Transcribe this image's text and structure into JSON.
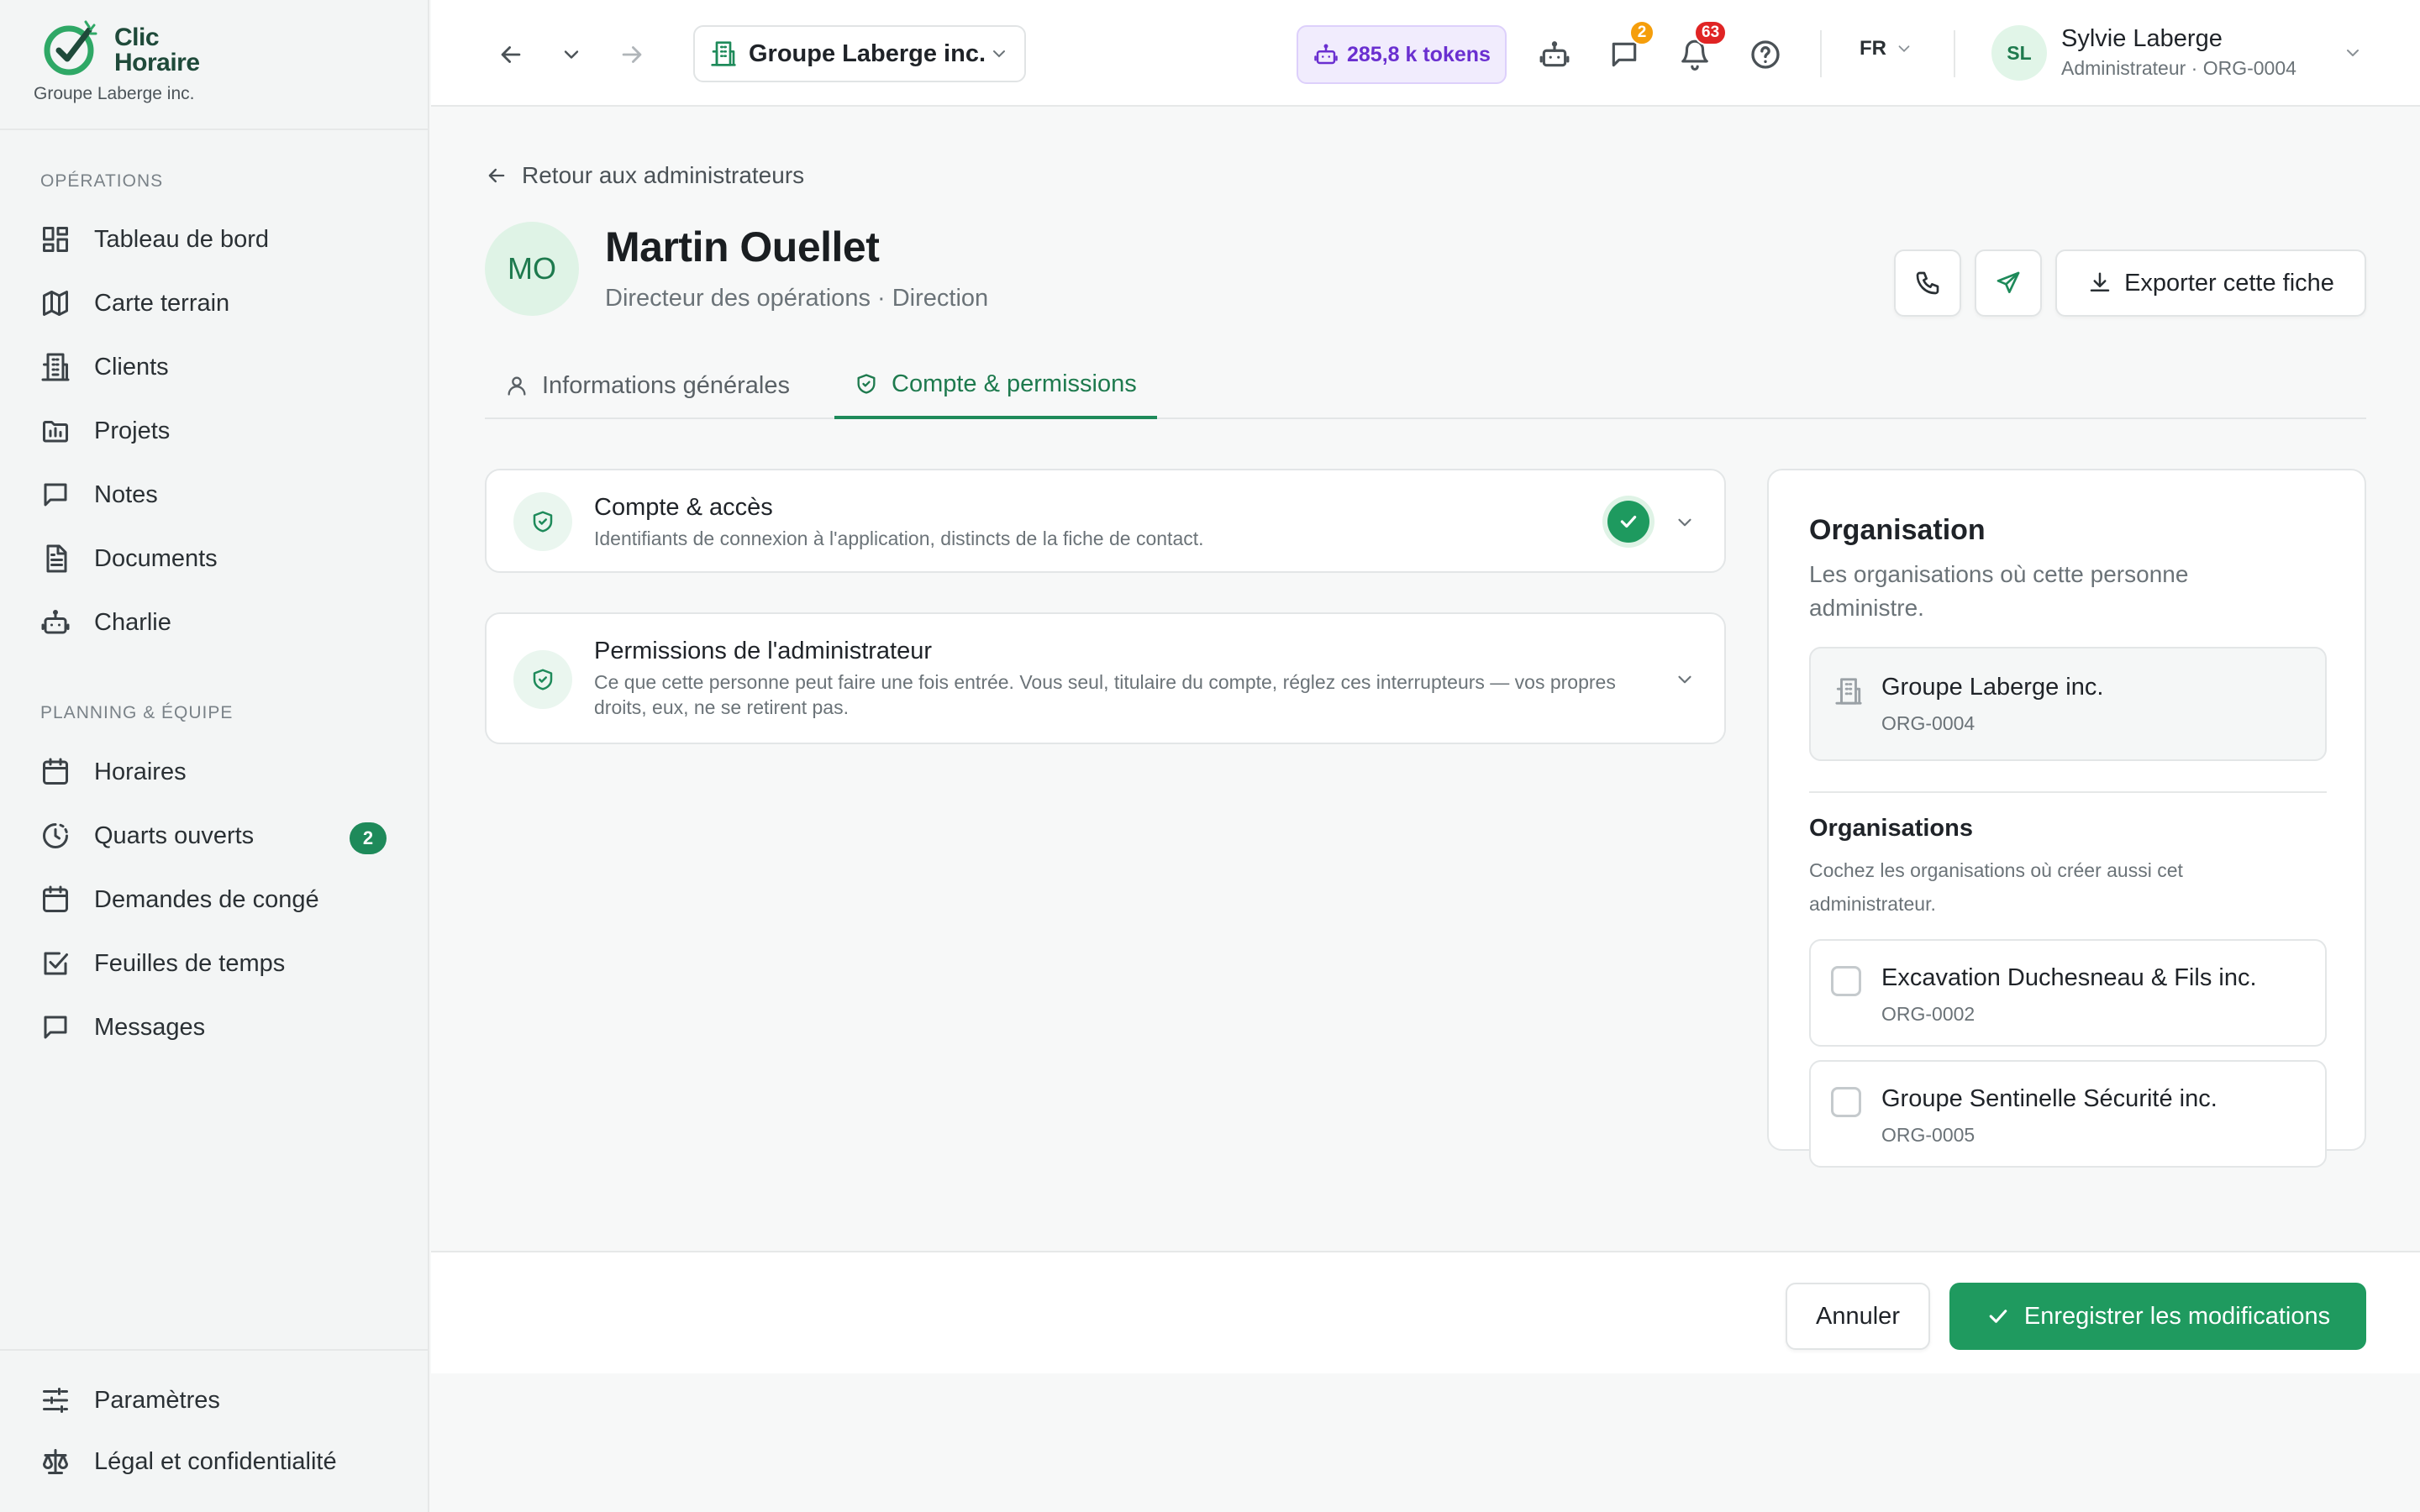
{
  "brand": {
    "logo_line1": "Clic",
    "logo_line2": "Horaire",
    "company": "Groupe Laberge inc."
  },
  "sidebar": {
    "section_operations": "OPÉRATIONS",
    "operations": [
      {
        "label": "Tableau de bord",
        "icon": "dashboard-icon"
      },
      {
        "label": "Carte terrain",
        "icon": "map-icon"
      },
      {
        "label": "Clients",
        "icon": "building-icon"
      },
      {
        "label": "Projets",
        "icon": "folder-icon"
      },
      {
        "label": "Notes",
        "icon": "chat-icon"
      },
      {
        "label": "Documents",
        "icon": "document-icon"
      },
      {
        "label": "Charlie",
        "icon": "robot-icon"
      }
    ],
    "section_planning": "PLANNING & ÉQUIPE",
    "planning": [
      {
        "label": "Horaires",
        "icon": "calendar-icon"
      },
      {
        "label": "Quarts ouverts",
        "icon": "clock-icon",
        "badge": "2"
      },
      {
        "label": "Demandes de congé",
        "icon": "calendar-icon"
      },
      {
        "label": "Feuilles de temps",
        "icon": "checkbox-icon"
      },
      {
        "label": "Messages",
        "icon": "chat-icon"
      }
    ],
    "bottom": [
      {
        "label": "Paramètres",
        "icon": "sliders-icon"
      },
      {
        "label": "Légal et confidentialité",
        "icon": "scale-icon"
      }
    ]
  },
  "topbar": {
    "org_switcher": "Groupe Laberge inc.",
    "tokens": "285,8 k tokens",
    "messages_badge": "2",
    "notifications_badge": "63",
    "language": "FR",
    "user_initials": "SL",
    "user_name": "Sylvie Laberge",
    "user_role": "Administrateur · ORG-0004"
  },
  "profile": {
    "back_label": "Retour aux administrateurs",
    "initials": "MO",
    "name": "Martin Ouellet",
    "role": "Directeur des opérations · Direction",
    "export_label": "Exporter cette fiche"
  },
  "tabs": [
    {
      "label": "Informations générales",
      "active": false
    },
    {
      "label": "Compte & permissions",
      "active": true
    }
  ],
  "sections": {
    "account": {
      "title": "Compte & accès",
      "description": "Identifiants de connexion à l'application, distincts de la fiche de contact."
    },
    "permissions": {
      "title": "Permissions de l'administrateur",
      "description": "Ce que cette personne peut faire une fois entrée. Vous seul, titulaire du compte, réglez ces interrupteurs — vos propres droits, eux, ne se retirent pas."
    }
  },
  "organisation": {
    "title": "Organisation",
    "subtitle": "Les organisations où cette personne administre.",
    "current": {
      "name": "Groupe Laberge inc.",
      "code": "ORG-0004"
    },
    "list_title": "Organisations",
    "list_subtitle": "Cochez les organisations où créer aussi cet administrateur.",
    "options": [
      {
        "name": "Excavation Duchesneau & Fils inc.",
        "code": "ORG-0002",
        "checked": false
      },
      {
        "name": "Groupe Sentinelle Sécurité inc.",
        "code": "ORG-0005",
        "checked": false
      }
    ]
  },
  "footer": {
    "cancel": "Annuler",
    "save": "Enregistrer les modifications"
  },
  "colors": {
    "accent": "#1f9a5f",
    "tokens": "#6a2fd0",
    "messages_badge": "#f59e0b",
    "notifications_badge": "#e02424"
  }
}
